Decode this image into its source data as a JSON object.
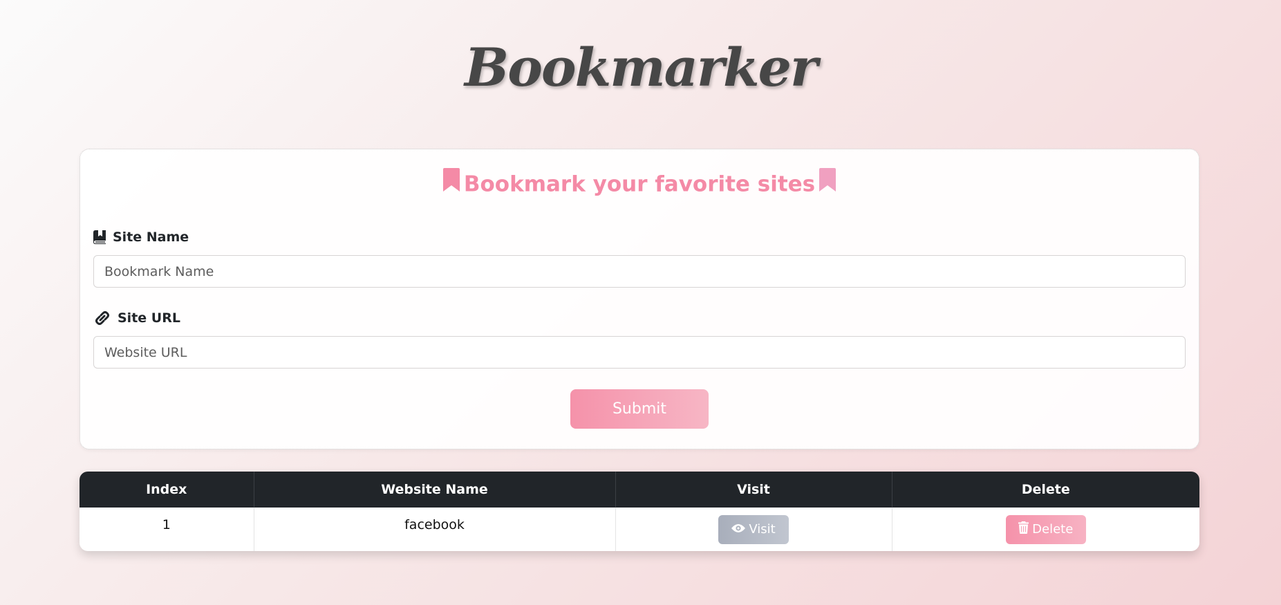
{
  "header": {
    "title": "Bookmarker"
  },
  "form": {
    "heading": "Bookmark your favorite sites",
    "site_name_label": "Site Name",
    "site_name_placeholder": "Bookmark Name",
    "site_name_value": "",
    "site_url_label": "Site URL",
    "site_url_placeholder": "Website URL",
    "site_url_value": "",
    "submit_label": "Submit"
  },
  "table": {
    "columns": [
      "Index",
      "Website Name",
      "Visit",
      "Delete"
    ],
    "rows": [
      {
        "index": "1",
        "website_name": "facebook",
        "visit_label": "Visit",
        "delete_label": "Delete"
      }
    ]
  },
  "icons": {
    "heading_left": "bookmark-icon",
    "heading_right": "bookmark-icon",
    "site_name": "book-bookmark-icon",
    "site_url": "link-icon",
    "visit": "eye-icon",
    "delete": "trash-icon"
  },
  "colors": {
    "accent_pink": "#f48aa6",
    "table_header": "#212529",
    "visit_button": "#b3b9c5"
  }
}
